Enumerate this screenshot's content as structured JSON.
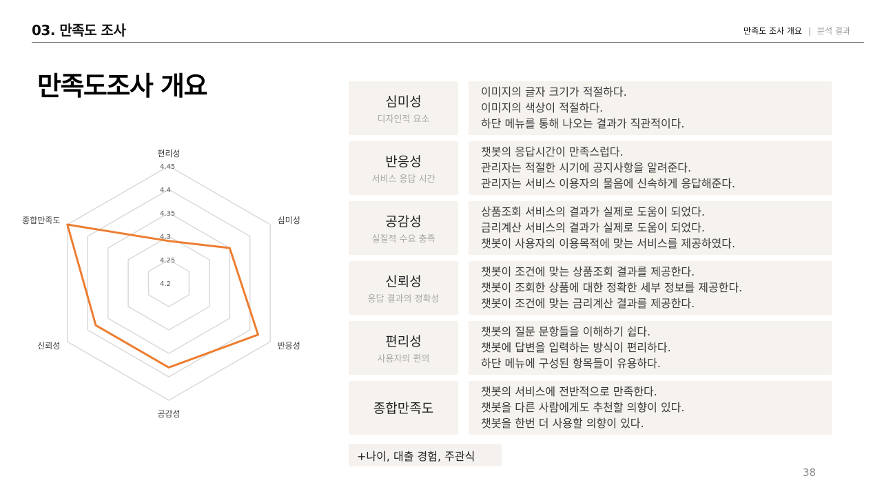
{
  "header": {
    "section_title": "03. 만족도 조사",
    "nav_active": "만족도 조사 개요",
    "nav_separator": "|",
    "nav_inactive": "분석 결과"
  },
  "page_title": "만족도조사 개요",
  "chart_data": {
    "type": "radar",
    "axes": [
      "편리성",
      "심미성",
      "반응성",
      "공감성",
      "신뢰성",
      "종합만족도"
    ],
    "tick_labels": [
      "4.2",
      "4.25",
      "4.3",
      "4.35",
      "4.4",
      "4.45"
    ],
    "range": [
      4.2,
      4.45
    ],
    "series": [
      {
        "values": [
          4.29,
          4.35,
          4.42,
          4.38,
          4.38,
          4.45
        ],
        "color": "#ed7d31"
      }
    ],
    "grid_color": "#d9d9d9"
  },
  "rows": [
    {
      "name": "심미성",
      "sub": "디자인적 요소",
      "lines": [
        "이미지의 글자 크기가 적절하다.",
        "이미지의 색상이 적절하다.",
        "하단 메뉴를 통해 나오는 결과가 직관적이다."
      ]
    },
    {
      "name": "반응성",
      "sub": "서비스 응답 시간",
      "lines": [
        "챗봇의 응답시간이 만족스럽다.",
        "관리자는 적절한 시기에 공지사항을 알려준다.",
        "관리자는 서비스 이용자의 물음에 신속하게 응답해준다."
      ]
    },
    {
      "name": "공감성",
      "sub": "실질적 수요 충족",
      "lines": [
        "상품조회 서비스의 결과가 실제로 도움이 되었다.",
        "금리계산 서비스의 결과가 실제로 도움이 되었다.",
        "챗봇이 사용자의 이용목적에 맞는 서비스를 제공하였다."
      ]
    },
    {
      "name": "신뢰성",
      "sub": "응답 결과의 정확성",
      "lines": [
        "챗봇이 조건에 맞는 상품조회 결과를 제공한다.",
        "챗봇이 조회한 상품에 대한 정확한 세부 정보를 제공한다.",
        "챗봇이 조건에 맞는 금리계산 결과를 제공한다."
      ]
    },
    {
      "name": "편리성",
      "sub": "사용자의 편의",
      "lines": [
        "챗봇의 질문 문항들을 이해하기 쉽다.",
        "챗봇에 답변을 입력하는 방식이 편리하다.",
        "하단 메뉴에 구성된 항목들이 유용하다."
      ]
    },
    {
      "name": "종합만족도",
      "sub": "",
      "lines": [
        "챗봇의 서비스에 전반적으로 만족한다.",
        "챗봇을 다른 사람에게도 추천할 의향이 있다.",
        "챗봇을 한번 더 사용할 의향이 있다."
      ]
    }
  ],
  "extra_note": "+나이, 대출 경험, 주관식",
  "page_number": "38"
}
